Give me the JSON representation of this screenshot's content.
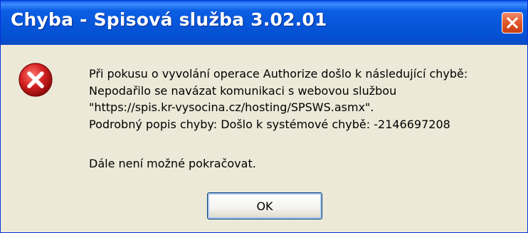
{
  "window": {
    "title": "Chyba - Spisová služba 3.02.01",
    "close_icon": "close-icon"
  },
  "icon": {
    "name": "error-icon",
    "color": "#d42222"
  },
  "message": {
    "line1": "Při pokusu o vyvolání operace Authorize došlo k následující chybě:",
    "line2": "Nepodařilo se navázat komunikaci s webovou službou",
    "line3": "\"https://spis.kr-vysocina.cz/hosting/SPSWS.asmx\".",
    "line4": "Podrobný popis chyby: Došlo k systémové chybě: -2146697208",
    "line5": "Dále není možné pokračovat."
  },
  "buttons": {
    "ok_label": "OK"
  },
  "colors": {
    "titlebar": "#0655d9",
    "dialog_bg": "#ece9d8",
    "close_button": "#e35b2f"
  }
}
